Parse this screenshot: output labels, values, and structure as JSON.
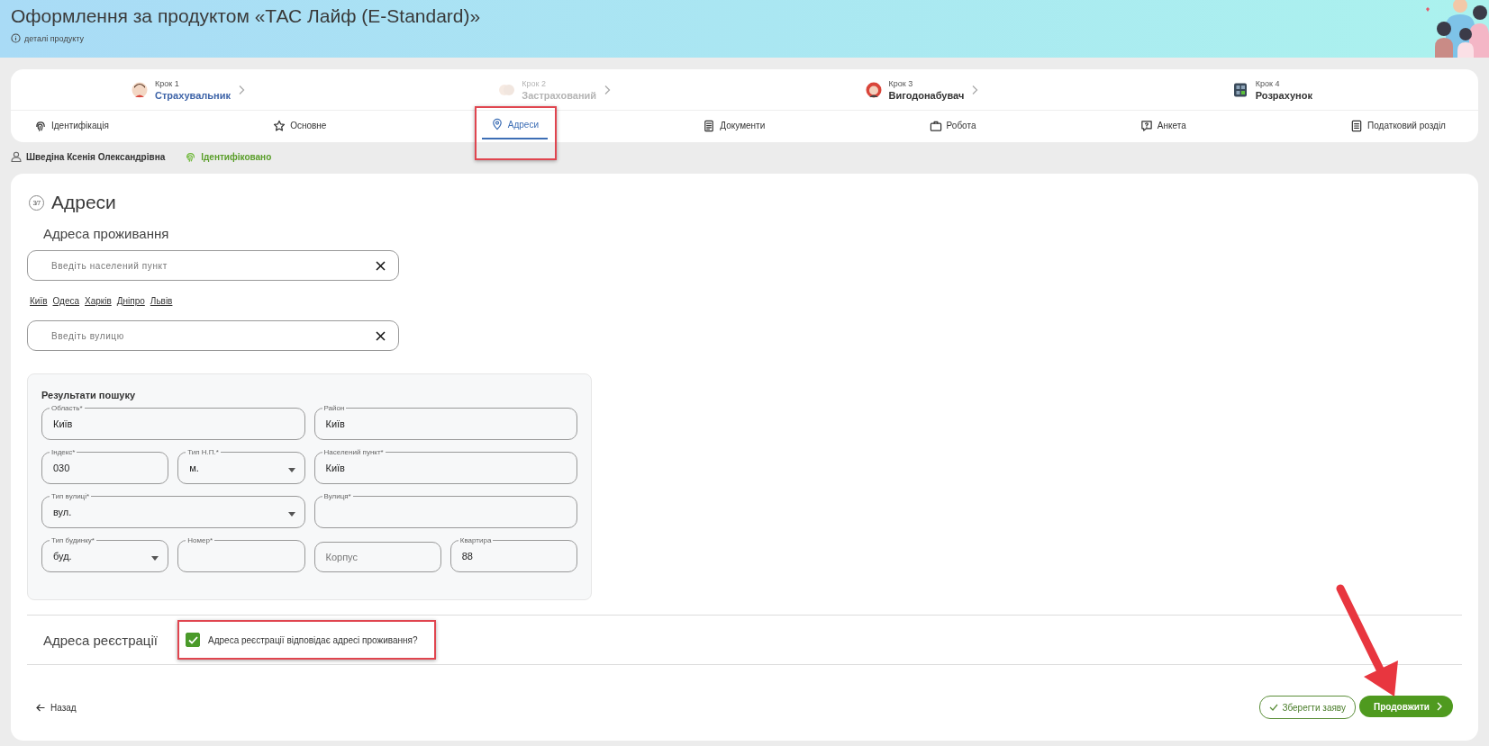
{
  "header": {
    "title": "Оформлення за продуктом «ТАС Лайф (E-Standard)»",
    "details_link": "деталі продукту"
  },
  "steps": [
    {
      "label": "Крок 1",
      "name": "Страхувальник",
      "selected": true,
      "disabled": false
    },
    {
      "label": "Крок 2",
      "name": "Застрахований",
      "selected": false,
      "disabled": true
    },
    {
      "label": "Крок 3",
      "name": "Вигодонабувач",
      "selected": false,
      "disabled": false
    },
    {
      "label": "Крок 4",
      "name": "Розрахунок",
      "selected": false,
      "disabled": false
    }
  ],
  "tabs": [
    {
      "label": "Ідентифікація",
      "selected": false,
      "highlighted": false
    },
    {
      "label": "Основне",
      "selected": false,
      "highlighted": false
    },
    {
      "label": "Адреси",
      "selected": true,
      "highlighted": true
    },
    {
      "label": "Документи",
      "selected": false,
      "highlighted": false
    },
    {
      "label": "Робота",
      "selected": false,
      "highlighted": false
    },
    {
      "label": "Анкета",
      "selected": false,
      "highlighted": false
    },
    {
      "label": "Податковий розділ",
      "selected": false,
      "highlighted": false
    }
  ],
  "client": {
    "name": "Шведіна Ксенія Олександрівна",
    "status": "Ідентифіковано"
  },
  "section": {
    "counter": "3/7",
    "title": "Адреси"
  },
  "residence": {
    "title": "Адреса проживання",
    "city_field": {
      "placeholder": "Введіть населений пункт"
    },
    "quick_cities": [
      "Київ",
      "Одеса",
      "Харків",
      "Дніпро",
      "Львів"
    ],
    "street_field": {
      "placeholder": "Введіть вулицю"
    }
  },
  "search_results": {
    "title": "Результати пошуку",
    "fields": [
      {
        "kind": "text",
        "label": "Область*",
        "value": "Київ"
      },
      {
        "kind": "text",
        "label": "Район",
        "value": "Київ"
      },
      {
        "kind": "text",
        "label": "Індекс*",
        "value": "030"
      },
      {
        "kind": "select",
        "label": "Тип Н.П.*",
        "value": "м."
      },
      {
        "kind": "text",
        "label": "Населений пункт*",
        "value": "Київ"
      },
      {
        "kind": "select",
        "label": "Тип вулиці*",
        "value": "вул."
      },
      {
        "kind": "text",
        "label": "Вулиця*"
      },
      {
        "kind": "select",
        "label": "Тип будинку*",
        "value": "буд."
      },
      {
        "kind": "text",
        "label": "Номер*"
      },
      {
        "kind": "text",
        "placeholder": "Корпус"
      },
      {
        "kind": "text",
        "label": "Квартира",
        "value": "88"
      }
    ]
  },
  "registration": {
    "title": "Адреса реєстрації",
    "same_as_residence": {
      "label": "Адреса реєстрації відповідає адресі проживання?",
      "checked": true,
      "highlighted": true
    }
  },
  "actions": {
    "back": "Назад",
    "save": "Зберегти заяву",
    "continue": "Продовжити",
    "continue_pointer": true
  }
}
